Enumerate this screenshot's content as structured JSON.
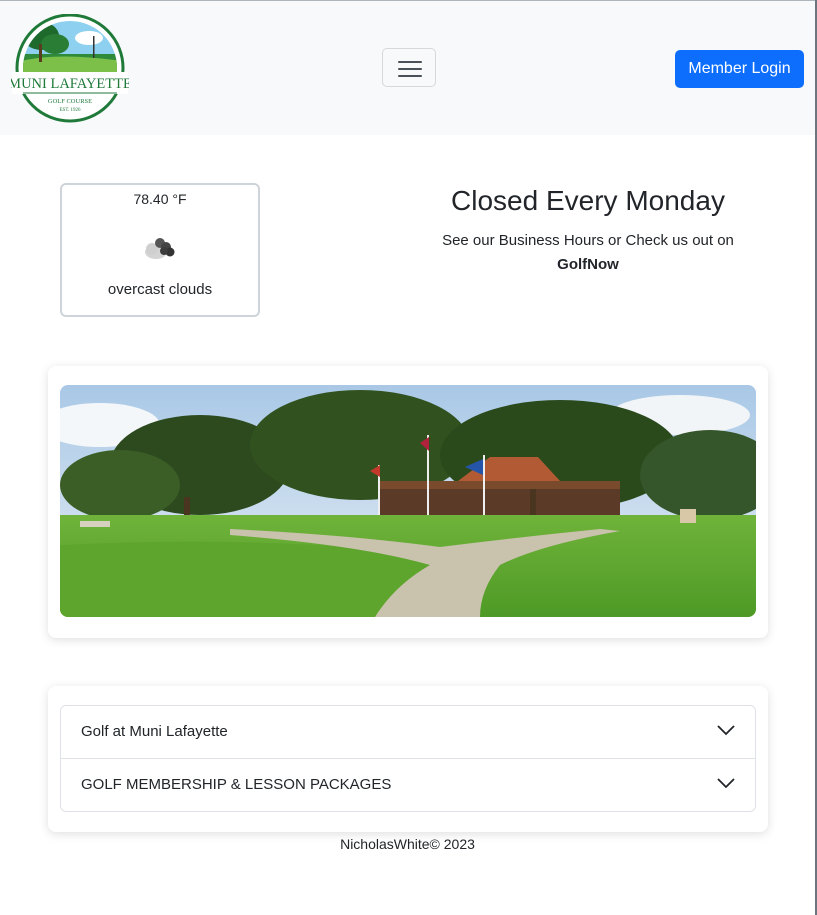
{
  "header": {
    "logo": {
      "name": "MUNI LAFAYETTE",
      "sub": "GOLF COURSE",
      "est": "EST. 1926"
    },
    "menu_icon": "hamburger-icon",
    "login_label": "Member Login"
  },
  "weather": {
    "temperature": "78.40 °F",
    "description": "overcast clouds",
    "icon": "cloud-icon"
  },
  "notice": {
    "title": "Closed Every Monday",
    "text": "See our Business Hours or Check us out on",
    "link_label": "GolfNow"
  },
  "accordion": {
    "items": [
      {
        "label": "Golf at Muni Lafayette"
      },
      {
        "label": "GOLF MEMBERSHIP & LESSON PACKAGES"
      }
    ]
  },
  "footer": {
    "text": "NicholasWhite© 2023"
  },
  "colors": {
    "primary": "#0d6efd",
    "navbar_bg": "#f8f9fa",
    "logo_green": "#1f7a3a"
  }
}
